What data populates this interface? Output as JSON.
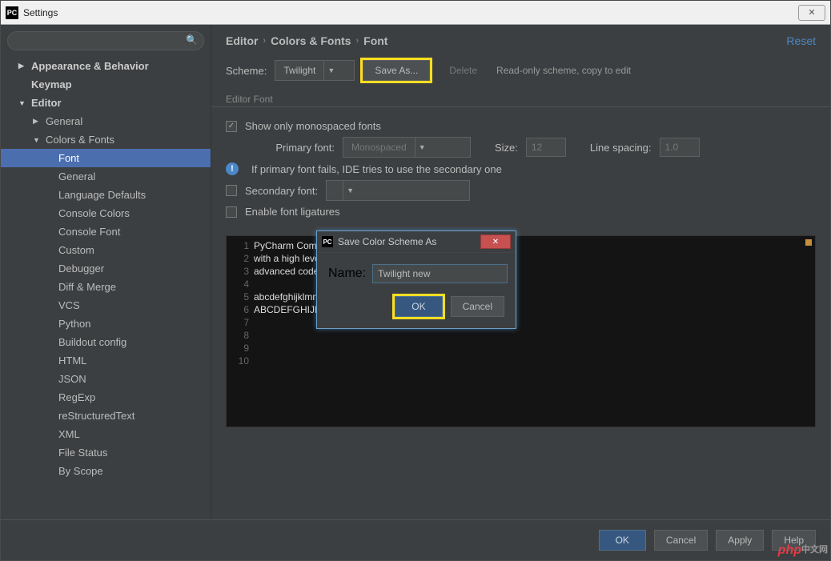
{
  "window": {
    "title": "Settings",
    "close_glyph": "✕"
  },
  "search": {
    "placeholder": "",
    "icon": "🔍"
  },
  "crumbs": {
    "a": "Editor",
    "b": "Colors & Fonts",
    "c": "Font",
    "reset": "Reset",
    "sep": "›"
  },
  "tree": {
    "appearance": "Appearance & Behavior",
    "keymap": "Keymap",
    "editor": "Editor",
    "general": "General",
    "colors_fonts": "Colors & Fonts",
    "items": [
      "Font",
      "General",
      "Language Defaults",
      "Console Colors",
      "Console Font",
      "Custom",
      "Debugger",
      "Diff & Merge",
      "VCS",
      "Python",
      "Buildout config",
      "HTML",
      "JSON",
      "RegExp",
      "reStructuredText",
      "XML",
      "File Status",
      "By Scope"
    ]
  },
  "scheme": {
    "label": "Scheme:",
    "value": "Twilight",
    "save_as": "Save As...",
    "delete": "Delete",
    "readonly_hint": "Read-only scheme, copy to edit"
  },
  "editor_font": {
    "legend": "Editor Font",
    "show_mono": "Show only monospaced fonts",
    "primary_label": "Primary font:",
    "primary_value": "Monospaced",
    "size_label": "Size:",
    "size_value": "12",
    "spacing_label": "Line spacing:",
    "spacing_value": "1.0",
    "info": "If primary font fails, IDE tries to use the secondary one",
    "secondary_label": "Secondary font:",
    "ligatures": "Enable font ligatures"
  },
  "preview": [
    "PyCharm Communit",
    "with a high leve",
    "advanced code ed",
    "",
    "abcdefghijklmnopqrstuvwxyz 0123456789 (){}[]",
    "ABCDEFGHIJKLMNOPQRSTUVWXYZ +-*/= .,;:!? #&$%@|^",
    "",
    "",
    "",
    ""
  ],
  "footer": {
    "ok": "OK",
    "cancel": "Cancel",
    "apply": "Apply",
    "help": "Help"
  },
  "dialog": {
    "title": "Save Color Scheme As",
    "name_label": "Name:",
    "name_value": "Twilight new",
    "ok": "OK",
    "cancel": "Cancel"
  },
  "watermark": {
    "a": "php",
    "b": "中文网"
  }
}
